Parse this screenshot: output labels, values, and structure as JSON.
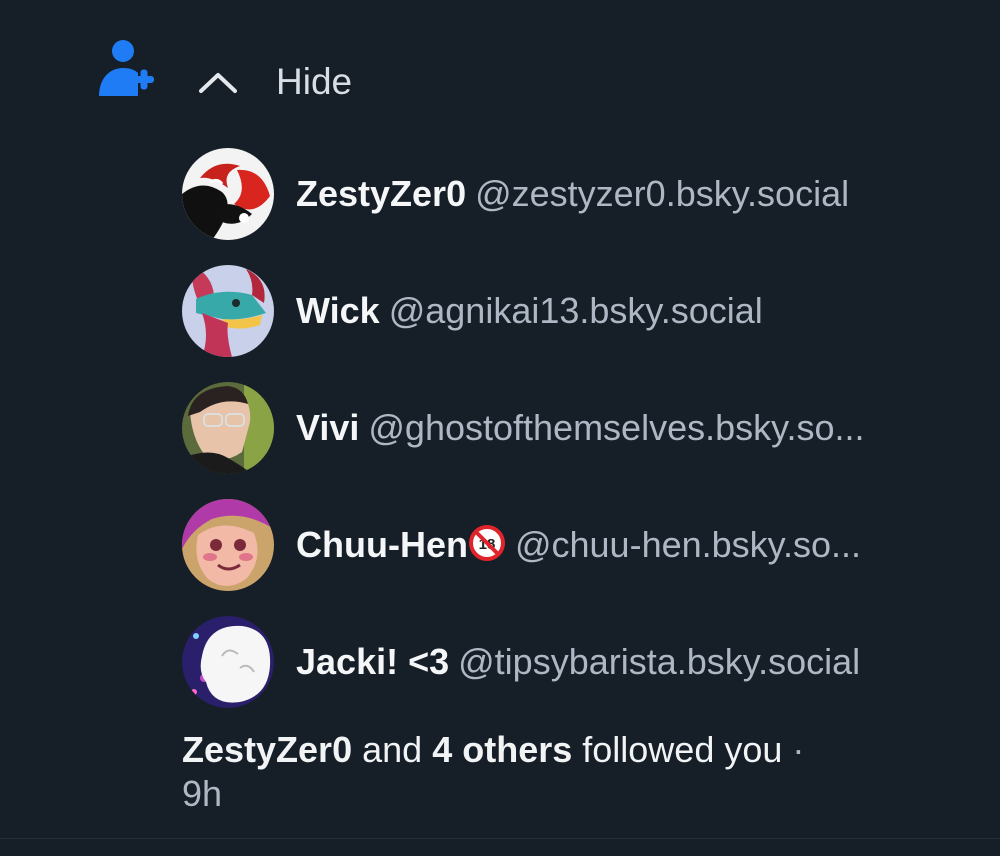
{
  "notification": {
    "icon": "person-add-icon",
    "accent_color": "#1f7cf4",
    "toggle_label": "Hide",
    "followers": [
      {
        "name": "ZestyZer0",
        "handle": "@zestyzer0.bsky.social"
      },
      {
        "name": "Wick",
        "handle": "@agnikai13.bsky.social"
      },
      {
        "name": "Vivi",
        "handle": "@ghostofthemselves.bsky.so..."
      },
      {
        "name": "Chuu-Hen",
        "badge": "🔞",
        "handle": "@chuu-hen.bsky.so..."
      },
      {
        "name": "Jacki! <3",
        "handle": "@tipsybarista.bsky.social"
      }
    ],
    "summary": {
      "first_name": "ZestyZer0",
      "and": "and",
      "others": "4 others",
      "followed": "followed you",
      "separator": "·",
      "time": "9h"
    }
  }
}
